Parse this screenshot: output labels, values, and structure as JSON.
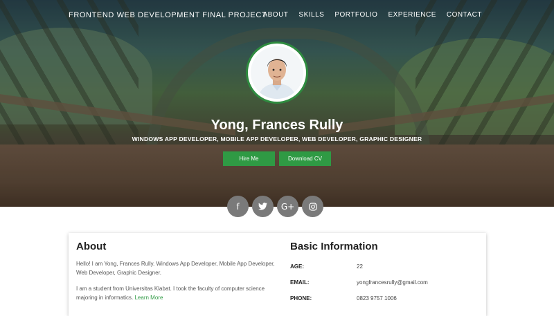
{
  "brand": "FRONTEND WEB DEVELOPMENT FINAL PROJECT",
  "nav": [
    "ABOUT",
    "SKILLS",
    "PORTFOLIO",
    "EXPERIENCE",
    "CONTACT"
  ],
  "hero": {
    "name": "Yong, Frances Rully",
    "roles": "WINDOWS APP DEVELOPER, MOBILE APP DEVELOPER, WEB DEVELOPER, GRAPHIC DESIGNER",
    "hire_label": "Hire Me",
    "cv_label": "Download CV"
  },
  "social": [
    {
      "icon": "facebook-icon",
      "glyph": "f"
    },
    {
      "icon": "twitter-icon",
      "glyph": "🐦"
    },
    {
      "icon": "google-plus-icon",
      "glyph": "G+"
    },
    {
      "icon": "instagram-icon",
      "glyph": "◙"
    }
  ],
  "about": {
    "title": "About",
    "p1": "Hello! I am Yong, Frances Rully. Windows App Developer, Mobile App Developer, Web Developer, Graphic Designer.",
    "p2": "I am a student from Universitas Klabat. I took the faculty of computer science majoring in informatics.",
    "learn_more": "Learn More"
  },
  "basic": {
    "title": "Basic Information",
    "rows": [
      {
        "k": "AGE:",
        "v": "22"
      },
      {
        "k": "EMAIL:",
        "v": "yongfrancesrully@gmail.com"
      },
      {
        "k": "PHONE:",
        "v": "0823 9757 1006"
      }
    ]
  },
  "colors": {
    "accent": "#2f9a44",
    "social_bg": "#7a7a7a"
  }
}
